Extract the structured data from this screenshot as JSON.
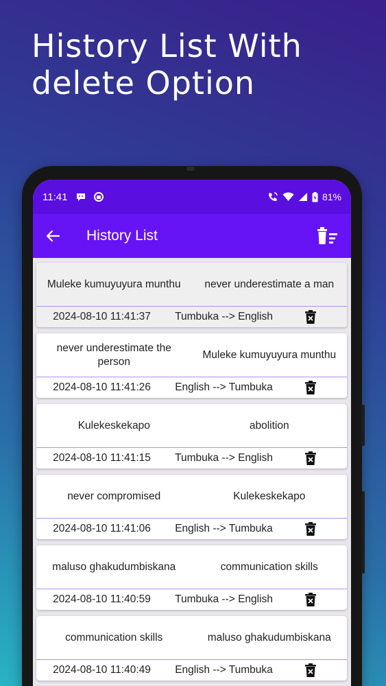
{
  "headline": {
    "line1": "History List With",
    "line2": "delete Option"
  },
  "status_bar": {
    "time": "11:41",
    "battery": "81%"
  },
  "app_bar": {
    "title": "History List"
  },
  "history": [
    {
      "source": "Muleke kumuyuyura munthu",
      "target": "never underestimate a man",
      "date": "2024-08-10 11:41:37",
      "direction": "Tumbuka --> English"
    },
    {
      "source": "never underestimate the person",
      "target": "Muleke kumuyuyura munthu",
      "date": "2024-08-10 11:41:26",
      "direction": "English --> Tumbuka"
    },
    {
      "source": "Kulekeskekapo",
      "target": "abolition",
      "date": "2024-08-10 11:41:15",
      "direction": "Tumbuka --> English"
    },
    {
      "source": "never compromised",
      "target": "Kulekeskekapo",
      "date": "2024-08-10 11:41:06",
      "direction": "English --> Tumbuka"
    },
    {
      "source": "maluso ghakudumbiskana",
      "target": "communication skills",
      "date": "2024-08-10 11:40:59",
      "direction": "Tumbuka --> English"
    },
    {
      "source": "communication skills",
      "target": "maluso ghakudumbiskana",
      "date": "2024-08-10 11:40:49",
      "direction": "English --> Tumbuka"
    }
  ],
  "icons": {
    "back": "arrow-left-icon",
    "clear_all": "delete-sweep-icon",
    "delete_item": "delete-icon",
    "chat": "chat-bubble-icon",
    "status_app": "app-status-icon",
    "call": "wifi-call-icon",
    "wifi": "wifi-icon",
    "signal": "signal-icon",
    "battery": "battery-icon"
  },
  "colors": {
    "status_bar": "#5a0fe0",
    "app_bar": "#6614f5",
    "divider": "#b38cf5",
    "list_background": "#e9e6ee"
  }
}
